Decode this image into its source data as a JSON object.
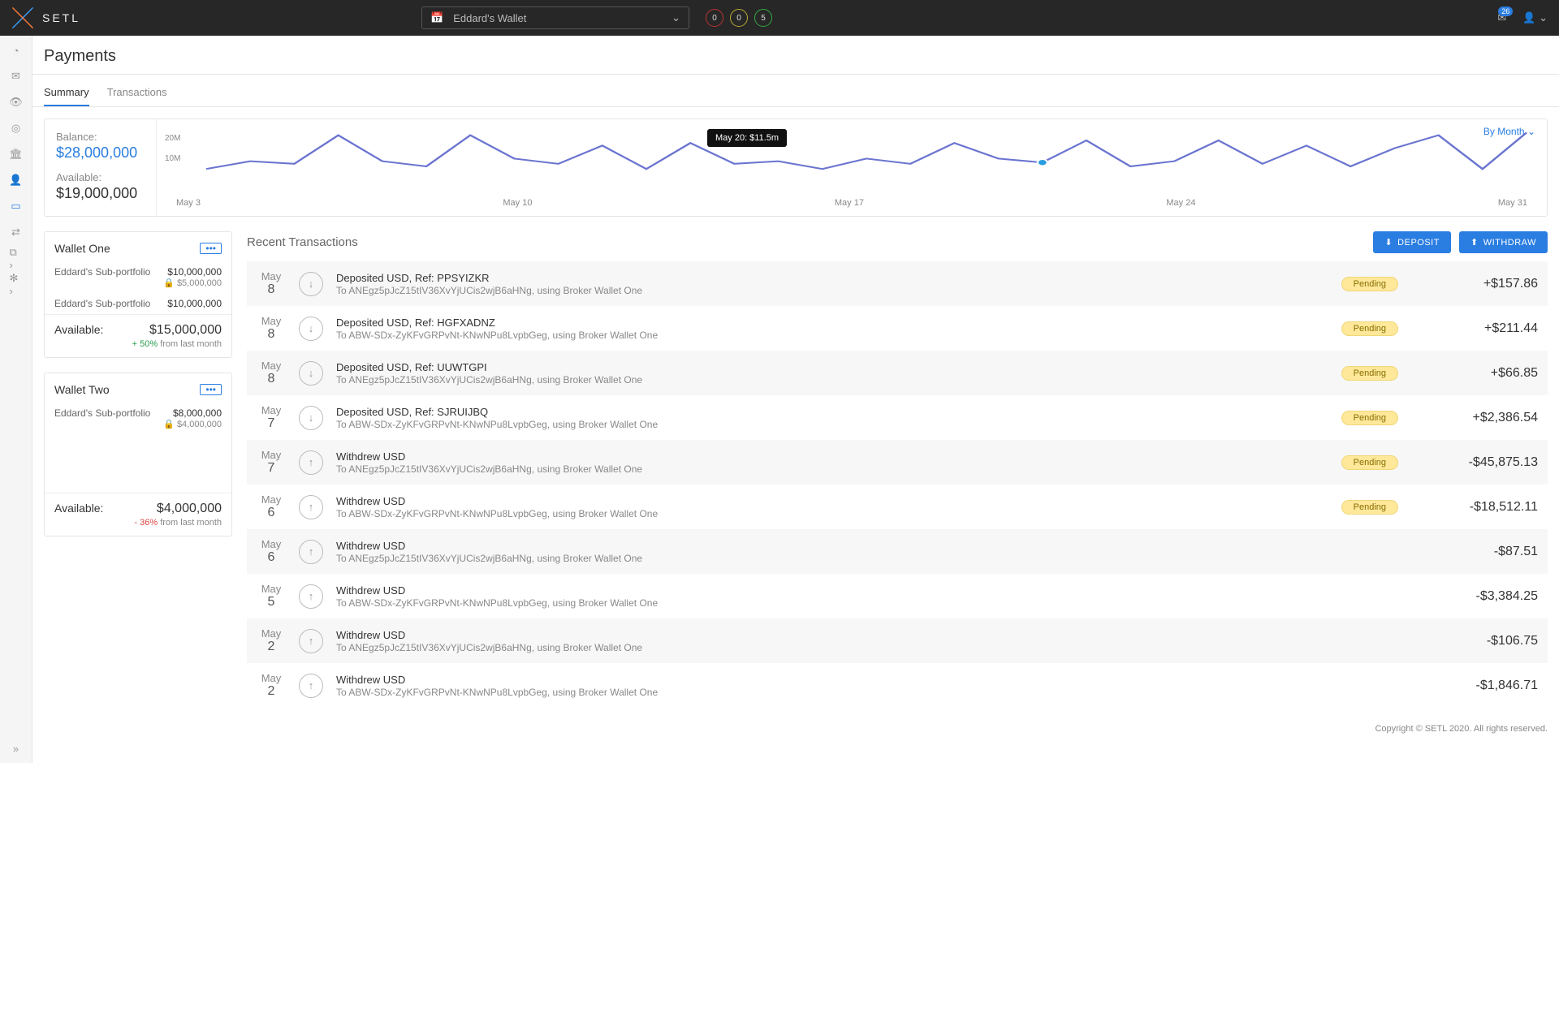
{
  "header": {
    "brand": "SETL",
    "wallet_selected": "Eddard's Wallet",
    "status": [
      "0",
      "0",
      "5"
    ],
    "notifications": "26"
  },
  "page": {
    "title": "Payments",
    "tabs": [
      "Summary",
      "Transactions"
    ]
  },
  "summary": {
    "balance_label": "Balance:",
    "balance": "$28,000,000",
    "available_label": "Available:",
    "available": "$19,000,000",
    "chart_filter": "By Month",
    "tooltip": "May 20: $11.5m"
  },
  "chart_data": {
    "type": "line",
    "title": "",
    "xlabel": "",
    "ylabel": "",
    "ylim": [
      0,
      25
    ],
    "y_ticks": [
      "20M",
      "10M"
    ],
    "x_ticks": [
      "May 3",
      "May 10",
      "May 17",
      "May 24",
      "May 31"
    ],
    "x": [
      "May 1",
      "May 2",
      "May 3",
      "May 4",
      "May 5",
      "May 6",
      "May 7",
      "May 8",
      "May 9",
      "May 10",
      "May 11",
      "May 12",
      "May 13",
      "May 14",
      "May 15",
      "May 16",
      "May 17",
      "May 18",
      "May 19",
      "May 20",
      "May 21",
      "May 22",
      "May 23",
      "May 24",
      "May 25",
      "May 26",
      "May 27",
      "May 28",
      "May 29",
      "May 30",
      "May 31"
    ],
    "values": [
      9,
      12,
      11,
      22,
      12,
      10,
      22,
      13,
      11,
      18,
      9,
      19,
      11,
      12,
      9,
      13,
      11,
      19,
      13,
      11.5,
      20,
      10,
      12,
      20,
      11,
      18,
      10,
      17,
      22,
      9,
      23
    ],
    "highlight_index": 19
  },
  "wallets": [
    {
      "name": "Wallet One",
      "subs": [
        {
          "label": "Eddard's Sub-portfolio",
          "amount": "$10,000,000",
          "locked": "$5,000,000"
        },
        {
          "label": "Eddard's Sub-portfolio",
          "amount": "$10,000,000",
          "locked": ""
        }
      ],
      "available_label": "Available:",
      "available": "$15,000,000",
      "delta": "+ 50%",
      "delta_class": "pos",
      "delta_suffix": "from last month"
    },
    {
      "name": "Wallet Two",
      "subs": [
        {
          "label": "Eddard's Sub-portfolio",
          "amount": "$8,000,000",
          "locked": "$4,000,000"
        }
      ],
      "available_label": "Available:",
      "available": "$4,000,000",
      "delta": "- 36%",
      "delta_class": "neg",
      "delta_suffix": "from last month"
    }
  ],
  "tx": {
    "title": "Recent Transactions",
    "deposit_btn": "DEPOSIT",
    "withdraw_btn": "WITHDRAW",
    "pending_label": "Pending",
    "rows": [
      {
        "month": "May",
        "day": "8",
        "dir": "in",
        "title": "Deposited USD, Ref: PPSYIZKR",
        "sub": "To ANEgz5pJcZ15tIV36XvYjUCis2wjB6aHNg, using Broker Wallet One",
        "status": true,
        "amount": "+$157.86"
      },
      {
        "month": "May",
        "day": "8",
        "dir": "in",
        "title": "Deposited USD, Ref: HGFXADNZ",
        "sub": "To ABW-SDx-ZyKFvGRPvNt-KNwNPu8LvpbGeg, using Broker Wallet One",
        "status": true,
        "amount": "+$211.44"
      },
      {
        "month": "May",
        "day": "8",
        "dir": "in",
        "title": "Deposited USD, Ref: UUWTGPI",
        "sub": "To ANEgz5pJcZ15tIV36XvYjUCis2wjB6aHNg, using Broker Wallet One",
        "status": true,
        "amount": "+$66.85"
      },
      {
        "month": "May",
        "day": "7",
        "dir": "in",
        "title": "Deposited USD, Ref: SJRUIJBQ",
        "sub": "To ABW-SDx-ZyKFvGRPvNt-KNwNPu8LvpbGeg, using Broker Wallet One",
        "status": true,
        "amount": "+$2,386.54"
      },
      {
        "month": "May",
        "day": "7",
        "dir": "out",
        "title": "Withdrew USD",
        "sub": "To ANEgz5pJcZ15tIV36XvYjUCis2wjB6aHNg, using Broker Wallet One",
        "status": true,
        "amount": "-$45,875.13"
      },
      {
        "month": "May",
        "day": "6",
        "dir": "out",
        "title": "Withdrew USD",
        "sub": "To ABW-SDx-ZyKFvGRPvNt-KNwNPu8LvpbGeg, using Broker Wallet One",
        "status": true,
        "amount": "-$18,512.11"
      },
      {
        "month": "May",
        "day": "6",
        "dir": "out",
        "title": "Withdrew USD",
        "sub": "To ANEgz5pJcZ15tIV36XvYjUCis2wjB6aHNg, using Broker Wallet One",
        "status": false,
        "amount": "-$87.51"
      },
      {
        "month": "May",
        "day": "5",
        "dir": "out",
        "title": "Withdrew USD",
        "sub": "To ABW-SDx-ZyKFvGRPvNt-KNwNPu8LvpbGeg, using Broker Wallet One",
        "status": false,
        "amount": "-$3,384.25"
      },
      {
        "month": "May",
        "day": "2",
        "dir": "out",
        "title": "Withdrew USD",
        "sub": "To ANEgz5pJcZ15tIV36XvYjUCis2wjB6aHNg, using Broker Wallet One",
        "status": false,
        "amount": "-$106.75"
      },
      {
        "month": "May",
        "day": "2",
        "dir": "out",
        "title": "Withdrew USD",
        "sub": "To ABW-SDx-ZyKFvGRPvNt-KNwNPu8LvpbGeg, using Broker Wallet One",
        "status": false,
        "amount": "-$1,846.71"
      }
    ]
  },
  "footer": "Copyright © SETL 2020. All rights reserved."
}
